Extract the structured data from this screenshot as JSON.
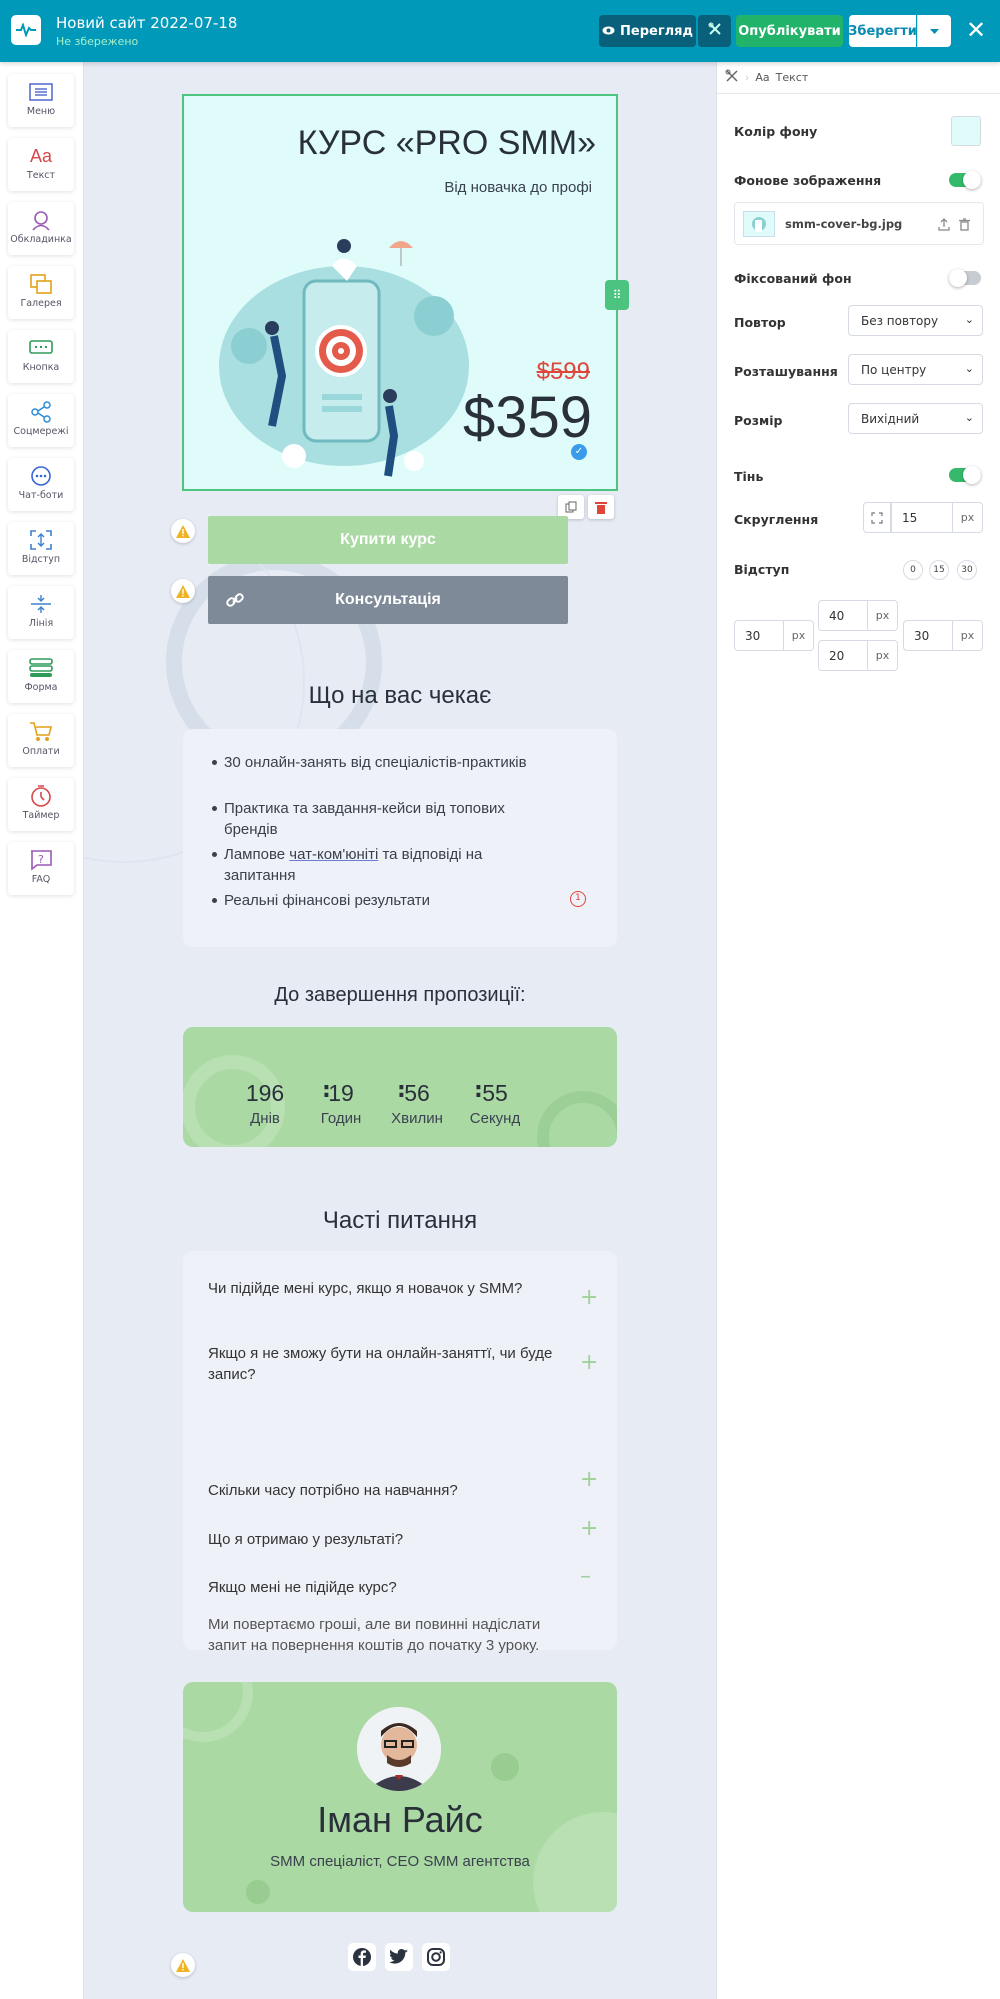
{
  "topbar": {
    "title": "Новий сайт 2022-07-18",
    "subtitle": "Не збережено",
    "preview_label": "Перегляд",
    "publish_label": "Опублікувати",
    "save_label": "Зберегти",
    "icons": [
      "pulse-logo-icon",
      "eye-icon",
      "tools-icon",
      "chevron-down-icon",
      "close-icon"
    ]
  },
  "sidebar": {
    "items": [
      {
        "label": "Меню",
        "icon": "menu-icon"
      },
      {
        "label": "Текст",
        "icon": "text-icon"
      },
      {
        "label": "Обкладинка",
        "icon": "cover-icon"
      },
      {
        "label": "Галерея",
        "icon": "gallery-icon"
      },
      {
        "label": "Кнопка",
        "icon": "button-icon"
      },
      {
        "label": "Соцмережі",
        "icon": "share-icon"
      },
      {
        "label": "Чат-боти",
        "icon": "chat-icon"
      },
      {
        "label": "Відступ",
        "icon": "spacing-icon"
      },
      {
        "label": "Лінія",
        "icon": "divider-icon"
      },
      {
        "label": "Форма",
        "icon": "form-icon"
      },
      {
        "label": "Оплати",
        "icon": "cart-icon"
      },
      {
        "label": "Таймер",
        "icon": "timer-icon"
      },
      {
        "label": "FAQ",
        "icon": "faq-icon"
      }
    ]
  },
  "canvas": {
    "cover": {
      "title": "КУРС «PRO SMM»",
      "subtitle": "Від новачка до профі",
      "old_price": "$599",
      "new_price": "$359"
    },
    "buy_button": "Купити курс",
    "consult_button": "Консультація",
    "what_heading": "Що на вас чекає",
    "bullets": [
      "30 онлайн-занять від спеціалістів-практиків",
      "Практика та завдання-кейси від топових брендів",
      "Лампове чат-ком'юніті та відповіді на запитання",
      "Реальні фінансові результати"
    ],
    "bullet_badge": "1",
    "countdown_heading": "До завершення пропозиції:",
    "countdown": {
      "values": [
        "196",
        "19",
        "56",
        "55"
      ],
      "labels": [
        "Днів",
        "Годин",
        "Хвилин",
        "Секунд"
      ],
      "sep": ":"
    },
    "faq_heading": "Часті питання",
    "faq": [
      {
        "q": "Чи підійде мені курс, якщо я новачок у SMM?",
        "toggle": "+"
      },
      {
        "q": "Якщо я не зможу бути на онлайн-заняттї, чи буде запис?",
        "toggle": "+"
      },
      {
        "q": "Скільки часу потрібно на навчання?",
        "toggle": "+"
      },
      {
        "q": "Що я отримаю у результаті?",
        "toggle": "+"
      },
      {
        "q": "Якщо мені не підійде курс?",
        "toggle": "–",
        "a": "Ми повертаємо гроші, але ви повинні надіслати запит на повернення коштів до початку 3 уроку."
      }
    ],
    "author": {
      "name": "Іман Райс",
      "role": "SMM спеціаліст, CEO SMM агентства"
    },
    "social": [
      "facebook-icon",
      "twitter-icon",
      "instagram-icon"
    ]
  },
  "panel": {
    "crumb": "Текст",
    "crumb_prefix": "Aa",
    "bg_color_label": "Колір фону",
    "bg_color": "#dffcfb",
    "bg_image_label": "Фонове зображення",
    "bg_image_file": "smm-cover-bg.jpg",
    "fixed_bg_label": "Фіксований фон",
    "repeat_label": "Повтор",
    "repeat_value": "Без повтору",
    "position_label": "Розташування",
    "position_value": "По центру",
    "size_label": "Розмір",
    "size_value": "Вихідний",
    "shadow_label": "Тінь",
    "radius_label": "Скруглення",
    "radius_value": "15",
    "unit": "px",
    "padding_label": "Відступ",
    "padding_presets": [
      "0",
      "15",
      "30"
    ],
    "padding": {
      "top": "40",
      "bottom": "20",
      "left": "30",
      "right": "30"
    },
    "toggles": {
      "bg_image": true,
      "fixed_bg": false,
      "shadow": true
    }
  },
  "colors": {
    "topbar": "#0199b9",
    "accent_green": "#21b36a",
    "button_green": "#abd9a4",
    "button_grey": "#7e8a97",
    "cover_bg": "#dffcfb",
    "old_price": "#e0453a"
  }
}
